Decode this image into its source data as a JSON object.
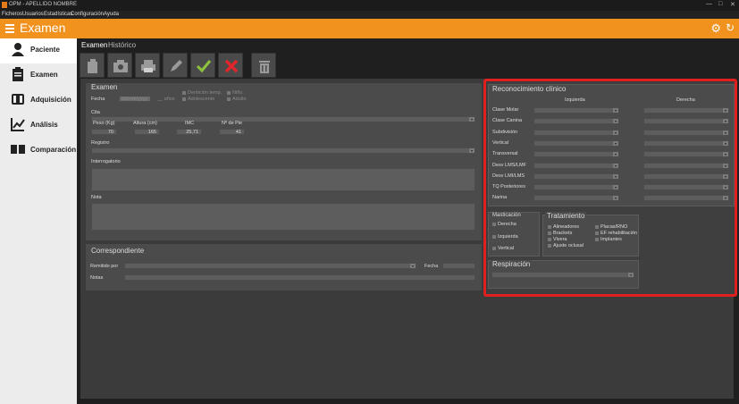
{
  "window": {
    "title": "OPM - APELLIDO NOMBRE",
    "controls": [
      "—",
      "□",
      "✕"
    ]
  },
  "menu": [
    "Ficheros",
    "Usuarios",
    "Estadísticas",
    "Configuración",
    "Ayuda"
  ],
  "header": {
    "title": "Examen"
  },
  "sidebar": {
    "items": [
      {
        "label": "Paciente",
        "icon": "user-icon"
      },
      {
        "label": "Examen",
        "icon": "clipboard-icon"
      },
      {
        "label": "Adquisición",
        "icon": "scanner-icon"
      },
      {
        "label": "Análisis",
        "icon": "chart-icon"
      },
      {
        "label": "Comparación",
        "icon": "compare-icon"
      }
    ]
  },
  "tabs": [
    "Examen",
    "Histórico"
  ],
  "examen": {
    "title": "Examen",
    "fecha_label": "Fecha",
    "fecha_value": "dd/mm/yyyy",
    "edad_label": "años",
    "checks": [
      "Dentición temp.",
      "Niño",
      "Adolescente",
      "Adulto"
    ],
    "cita_label": "Cita",
    "peso_label": "Peso (Kg)",
    "peso_value": "70",
    "altura_label": "Altura (cm)",
    "altura_value": "165",
    "imc_label": "IMC",
    "imc_value": "25,71",
    "pie_label": "Nº de Pie",
    "pie_value": "41",
    "registro_label": "Registro",
    "interrogatorio_label": "Interrogatorio",
    "nota_label": "Nota"
  },
  "correspondiente": {
    "title": "Correspondiente",
    "remitido_label": "Remitido por",
    "fecha_label": "Fecha",
    "notas_label": "Notas"
  },
  "reconocimiento": {
    "title": "Reconocimiento clínico",
    "col_left": "Izquierda",
    "col_right": "Derecha",
    "rows": [
      "Clase Molar",
      "Clase Canina",
      "Subdivisión",
      "Vertical",
      "Transversal",
      "Desv LMS/LMF",
      "Desv LMI/LMS",
      "TQ Posteriores",
      "Narina"
    ]
  },
  "masticacion": {
    "title": "Masticación",
    "options": [
      "Derecha",
      "Izquierda",
      "Vertical"
    ]
  },
  "tratamiento": {
    "title": "Tratamiento",
    "col1": [
      "Alineadores",
      "Brackets",
      "Vivera",
      "Ajuste oclusal"
    ],
    "col2": [
      "Placas/RNO",
      "EF rehabilitación",
      "Implantes"
    ]
  },
  "respiracion": {
    "title": "Respiración"
  }
}
